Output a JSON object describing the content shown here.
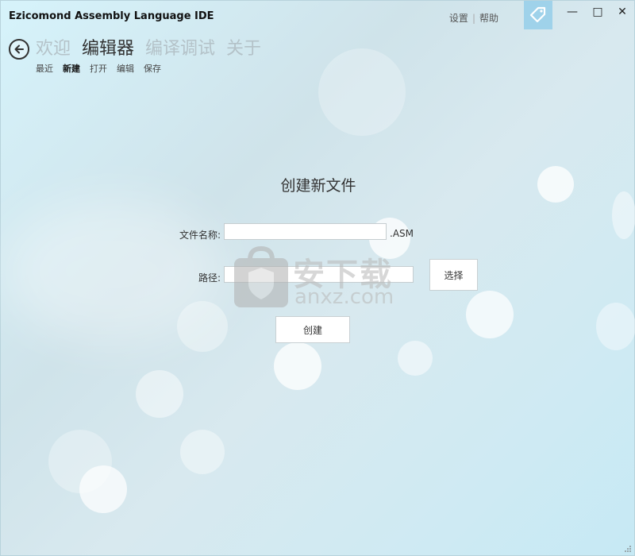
{
  "window": {
    "title": "Ezicomond Assembly Language IDE",
    "links": {
      "settings": "设置",
      "help": "帮助"
    },
    "controls": {
      "minimize": "—",
      "maximize": "□",
      "close": "✕"
    }
  },
  "nav": {
    "main": [
      "欢迎",
      "编辑器",
      "编译调试",
      "关于"
    ],
    "main_active": 1,
    "sub": [
      "最近",
      "新建",
      "打开",
      "编辑",
      "保存"
    ],
    "sub_active": 1
  },
  "form": {
    "title": "创建新文件",
    "filename_label": "文件名称:",
    "filename_value": "",
    "extension": ".ASM",
    "path_label": "路径:",
    "path_value": "",
    "browse_label": "选择",
    "create_label": "创建"
  },
  "watermark": {
    "cn": "安下载",
    "en": "anxz.com"
  },
  "colors": {
    "accent": "#9fd2ea",
    "text": "#333333",
    "inactive_nav": "#b4c2c8"
  }
}
